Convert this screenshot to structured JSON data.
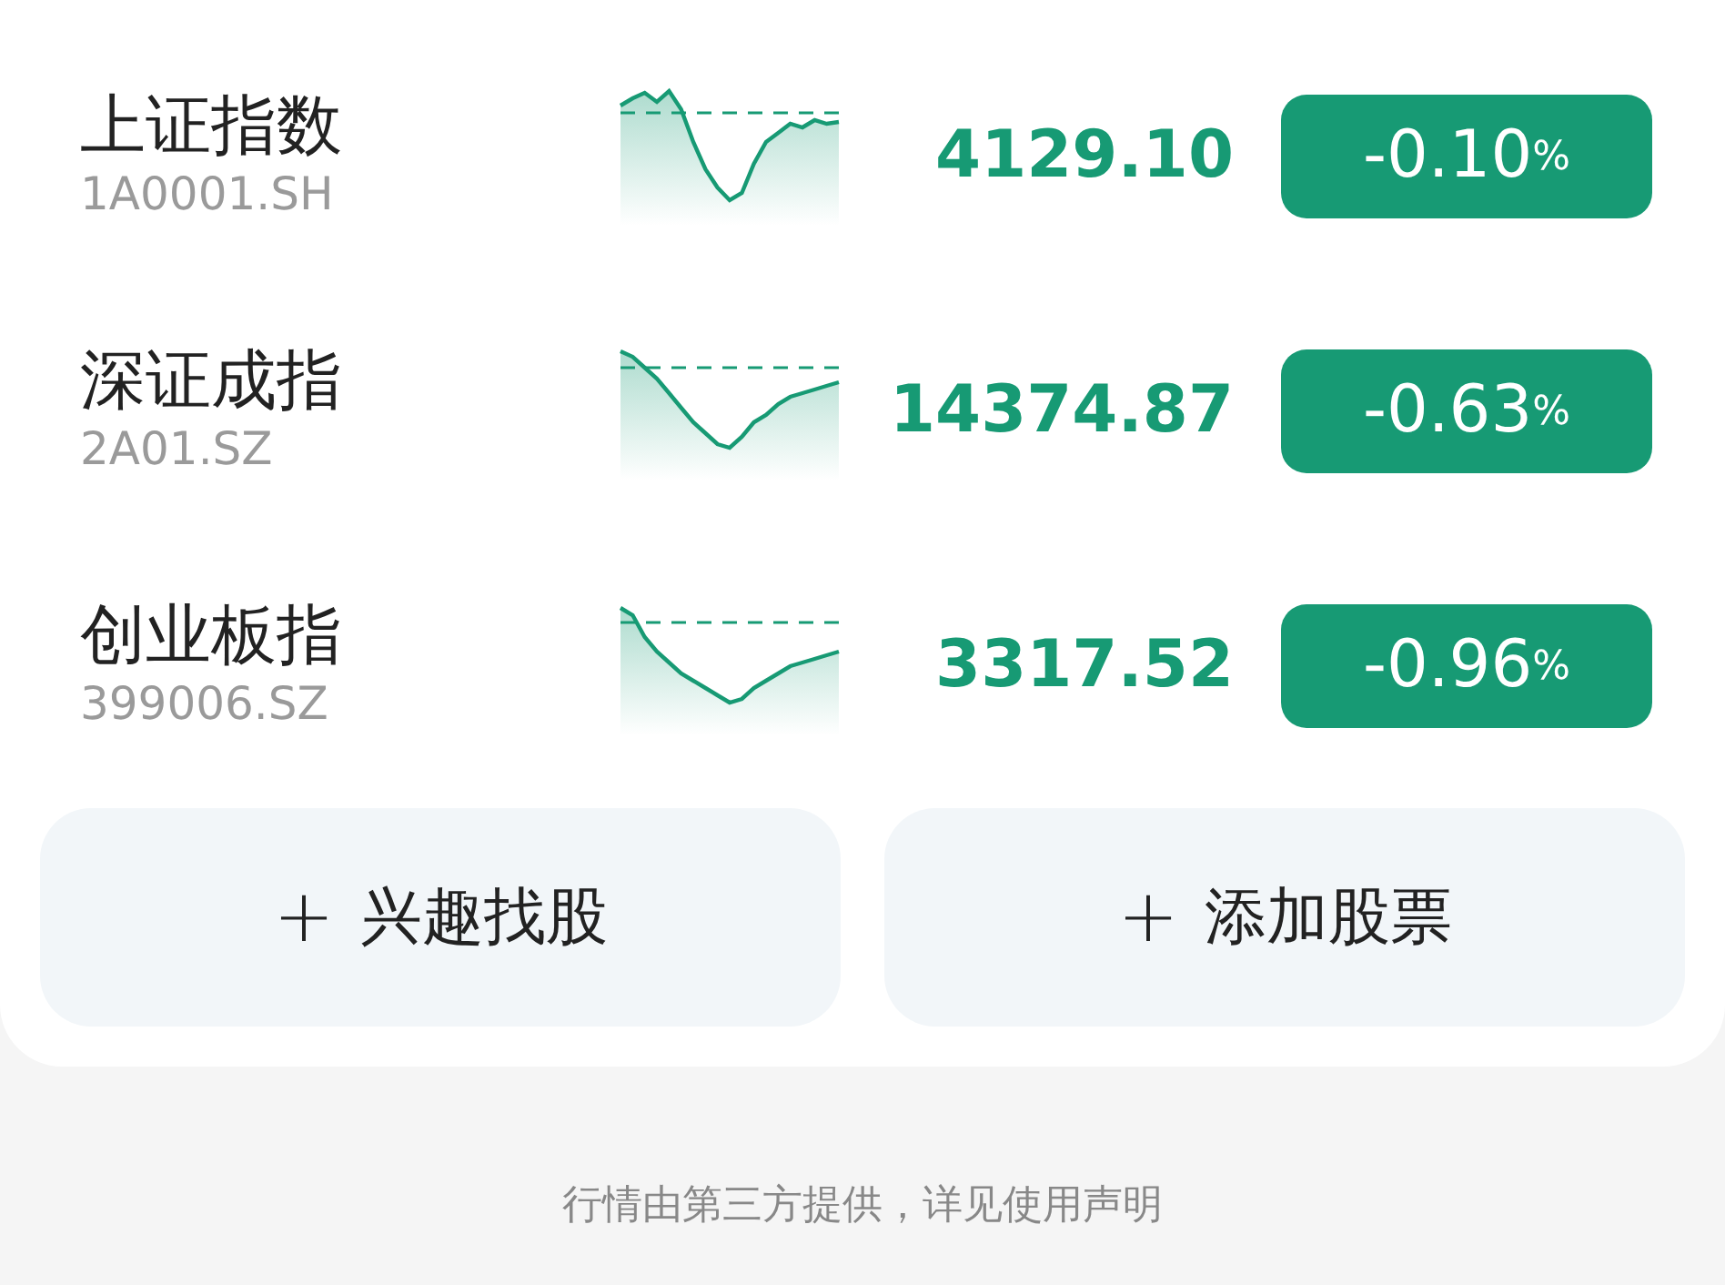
{
  "indices": [
    {
      "name": "上证指数",
      "code": "1A0001.SH",
      "price": "4129.10",
      "change": "-0.10",
      "unit": "%",
      "color": "#179a74"
    },
    {
      "name": "深证成指",
      "code": "2A01.SZ",
      "price": "14374.87",
      "change": "-0.63",
      "unit": "%",
      "color": "#179a74"
    },
    {
      "name": "创业板指",
      "code": "399006.SZ",
      "price": "3317.52",
      "change": "-0.96",
      "unit": "%",
      "color": "#179a74"
    }
  ],
  "buttons": [
    {
      "icon": "+",
      "label": "兴趣找股"
    },
    {
      "icon": "+",
      "label": "添加股票"
    }
  ],
  "footer": "行情由第三方提供，详见使用声明"
}
